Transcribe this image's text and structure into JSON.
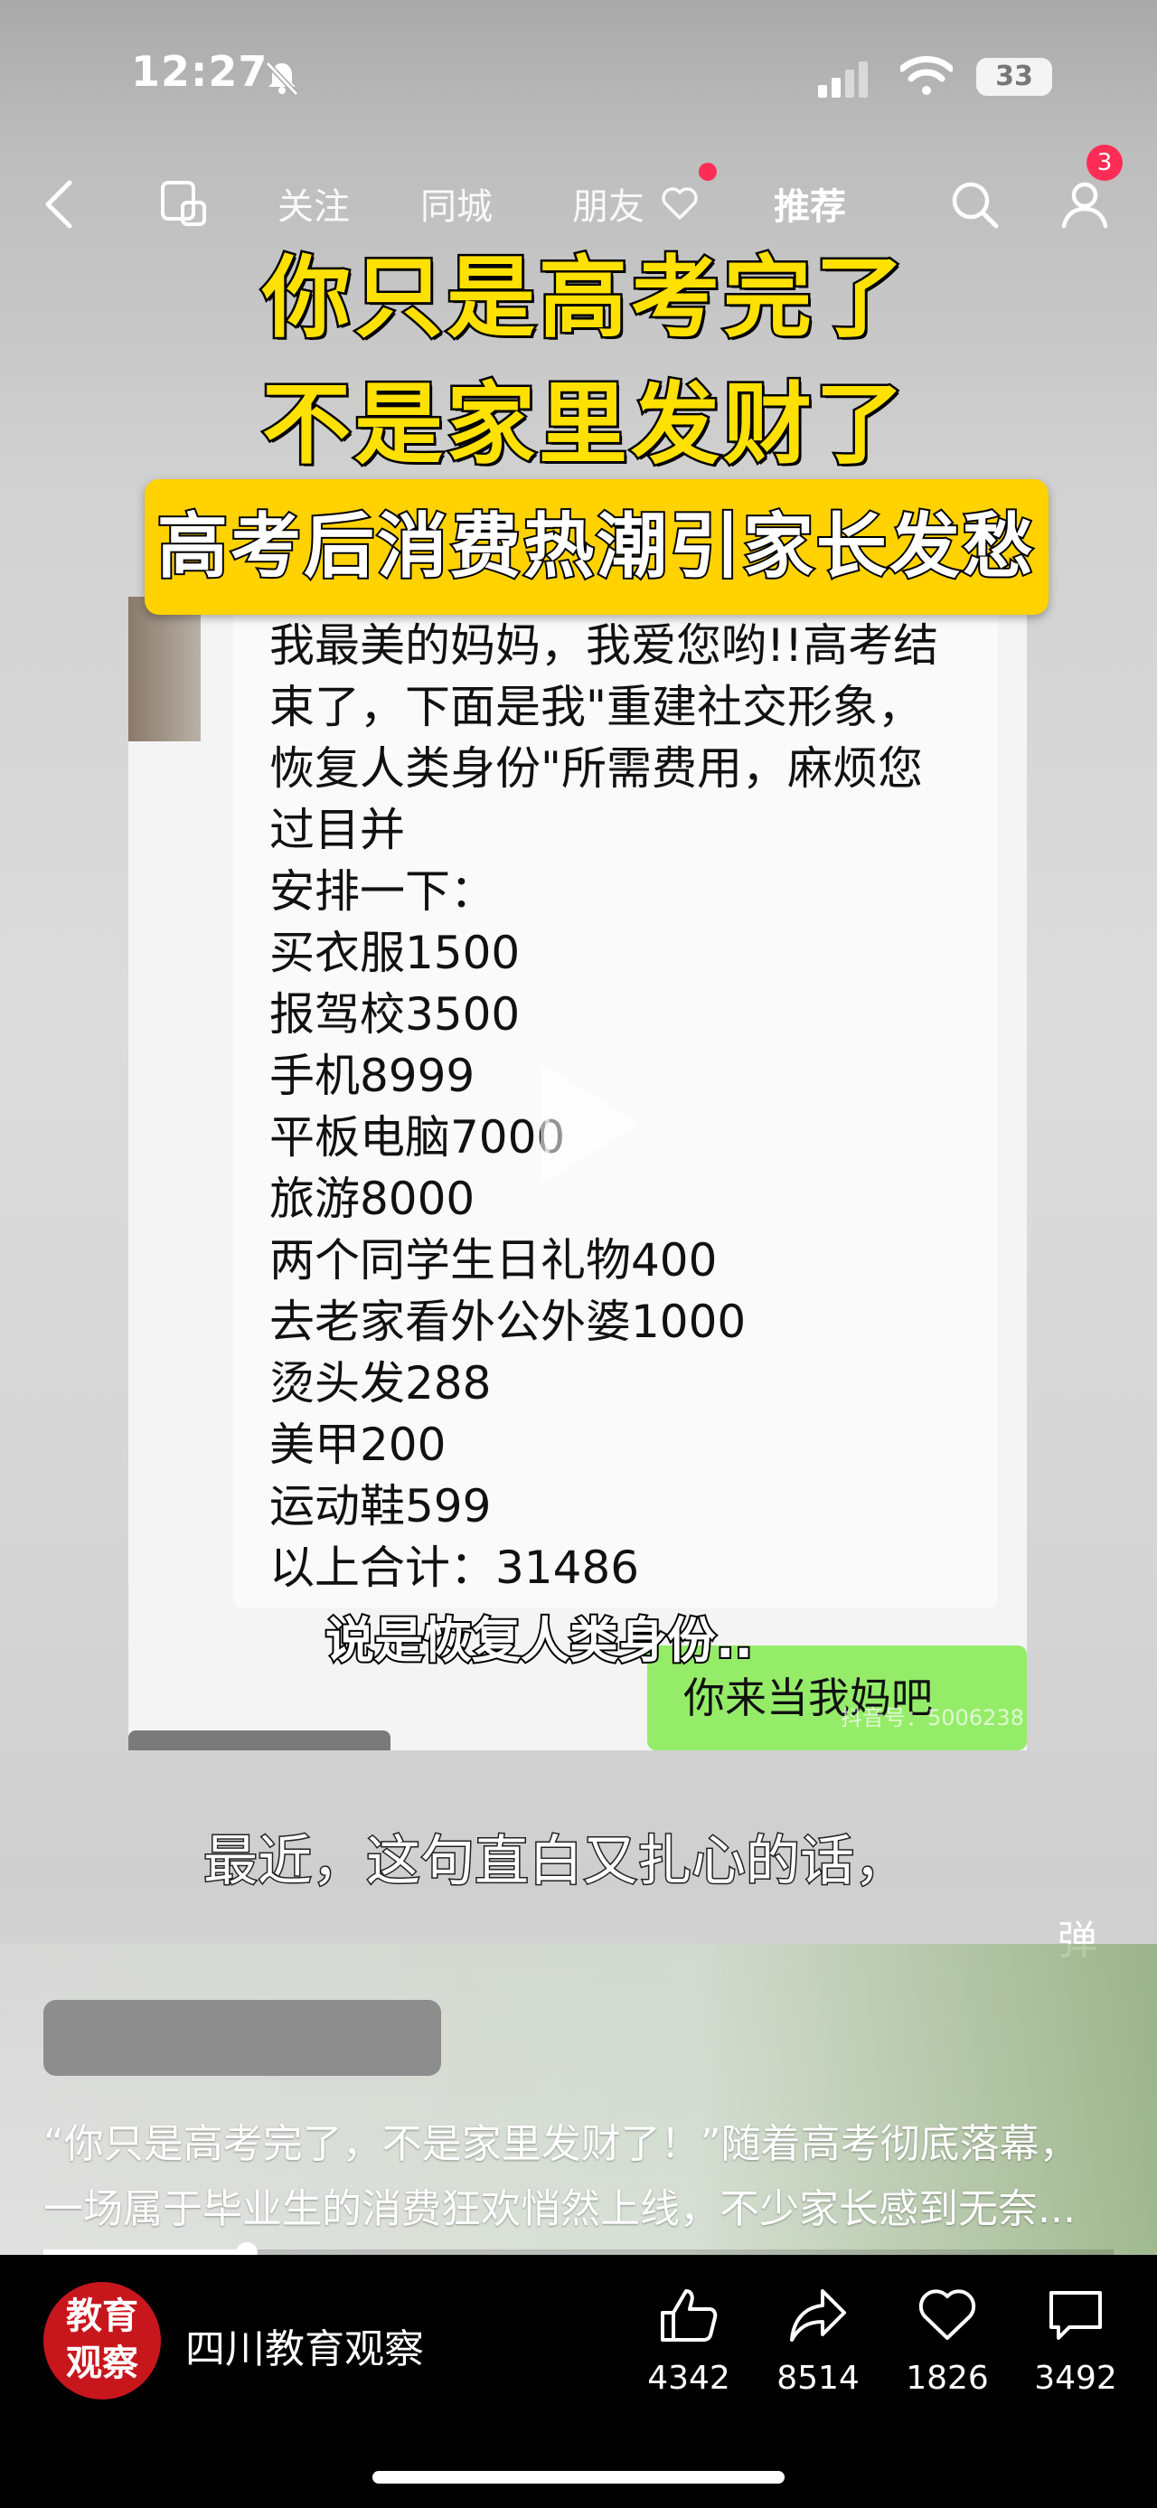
{
  "status_bar": {
    "time": "12:27",
    "battery": "33"
  },
  "nav": {
    "tabs": [
      "关注",
      "同城",
      "朋友",
      "推荐"
    ],
    "active_tab": "推荐",
    "notification_badge": "3"
  },
  "video": {
    "title_line1": "你只是高考完了",
    "title_line2": "不是家里发财了",
    "banner": "高考后消费热潮引家长发愁",
    "chat_lines": [
      "我最美的妈妈，我爱您哟!!高考结",
      "束了，下面是我\"重建社交形象，",
      "恢复人类身份\"所需费用，麻烦您",
      "过目并",
      "安排一下：",
      "买衣服1500",
      "报驾校3500",
      "手机8999",
      "平板电脑7000",
      "旅游8000",
      "两个同学生日礼物400",
      "去老家看外公外婆1000",
      "烫头发288",
      "美甲200",
      "运动鞋599",
      "以上合计：31486"
    ],
    "inner_subtitle": "说是恢复人类身份..",
    "reply_bubble": "你来当我妈吧",
    "watermark": "抖音号：5006238",
    "caption": "最近，这句直白又扎心的话，",
    "danmu_label": "弹"
  },
  "description": {
    "line1": "“你只是高考完了，不是家里发财了！”随着高考彻底落幕，",
    "line2": "一场属于毕业生的消费狂欢悄然上线，不少家长感到无奈..."
  },
  "progress": 0.19,
  "bottom_bar": {
    "logo_text": [
      "教育",
      "观察"
    ],
    "channel_name": "四川教育观察",
    "likes": "4342",
    "shares": "8514",
    "favorites": "1826",
    "comments": "3492"
  },
  "colors": {
    "title_yellow": "#ffe100",
    "banner_yellow": "#ffd200",
    "reply_green": "#95ec69",
    "logo_red": "#c8161d"
  }
}
